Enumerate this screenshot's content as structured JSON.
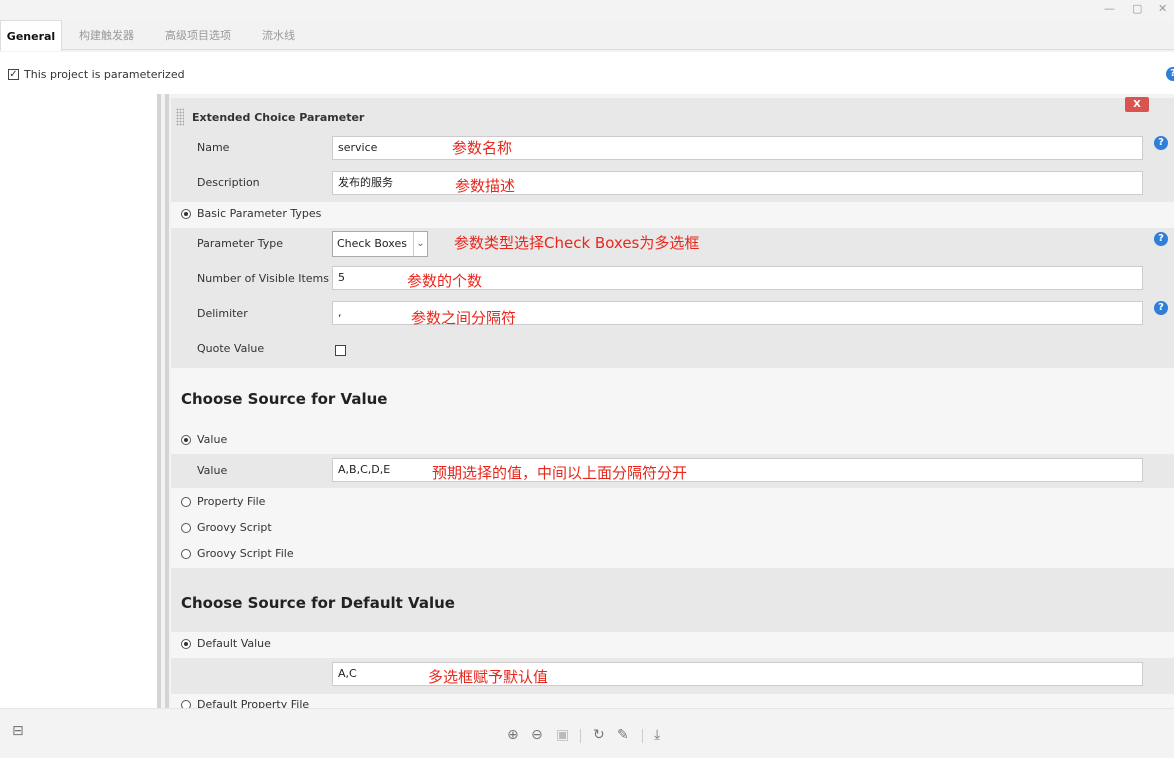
{
  "window": {
    "minimize_icon": "—",
    "maximize_icon": "▢",
    "close_icon": "✕"
  },
  "tabs": [
    {
      "label": "General"
    },
    {
      "label": "构建触发器"
    },
    {
      "label": "高级项目选项"
    },
    {
      "label": "流水线"
    }
  ],
  "parameterized": {
    "label": "This project is parameterized",
    "checked": true
  },
  "param_block": {
    "title": "Extended Choice Parameter",
    "delete_label": "X",
    "name": {
      "label": "Name",
      "value": "service"
    },
    "description": {
      "label": "Description",
      "value": "发布的服务"
    },
    "basic_types": {
      "label": "Basic Parameter Types",
      "parameter_type": {
        "label": "Parameter Type",
        "value": "Check Boxes"
      },
      "visible_items": {
        "label": "Number of Visible Items",
        "value": "5"
      },
      "delimiter": {
        "label": "Delimiter",
        "value": ","
      },
      "quote_value": {
        "label": "Quote Value"
      }
    },
    "value_source": {
      "title": "Choose Source for Value",
      "value_radio": "Value",
      "value": {
        "label": "Value",
        "value": "A,B,C,D,E"
      },
      "property_file": "Property File",
      "groovy_script": "Groovy Script",
      "groovy_script_file": "Groovy Script File"
    },
    "default_source": {
      "title": "Choose Source for Default Value",
      "default_radio": "Default Value",
      "default_value": "A,C",
      "default_property_file": "Default Property File"
    }
  },
  "annotations": {
    "name": "参数名称",
    "description": "参数描述",
    "type": "参数类型选择Check Boxes为多选框",
    "count": "参数的个数",
    "delimiter": "参数之间分隔符",
    "value": "预期选择的值，中间以上面分隔符分开",
    "default": "多选框赋予默认值"
  },
  "help_icon": "?",
  "toolbar": {
    "panel_icon": "⊟",
    "zoom_in_icon": "⊕",
    "zoom_out_icon": "⊖",
    "actual_size_icon": "▣",
    "rotate_icon": "↻",
    "edit_icon": "✎",
    "download_icon": "⤓"
  }
}
